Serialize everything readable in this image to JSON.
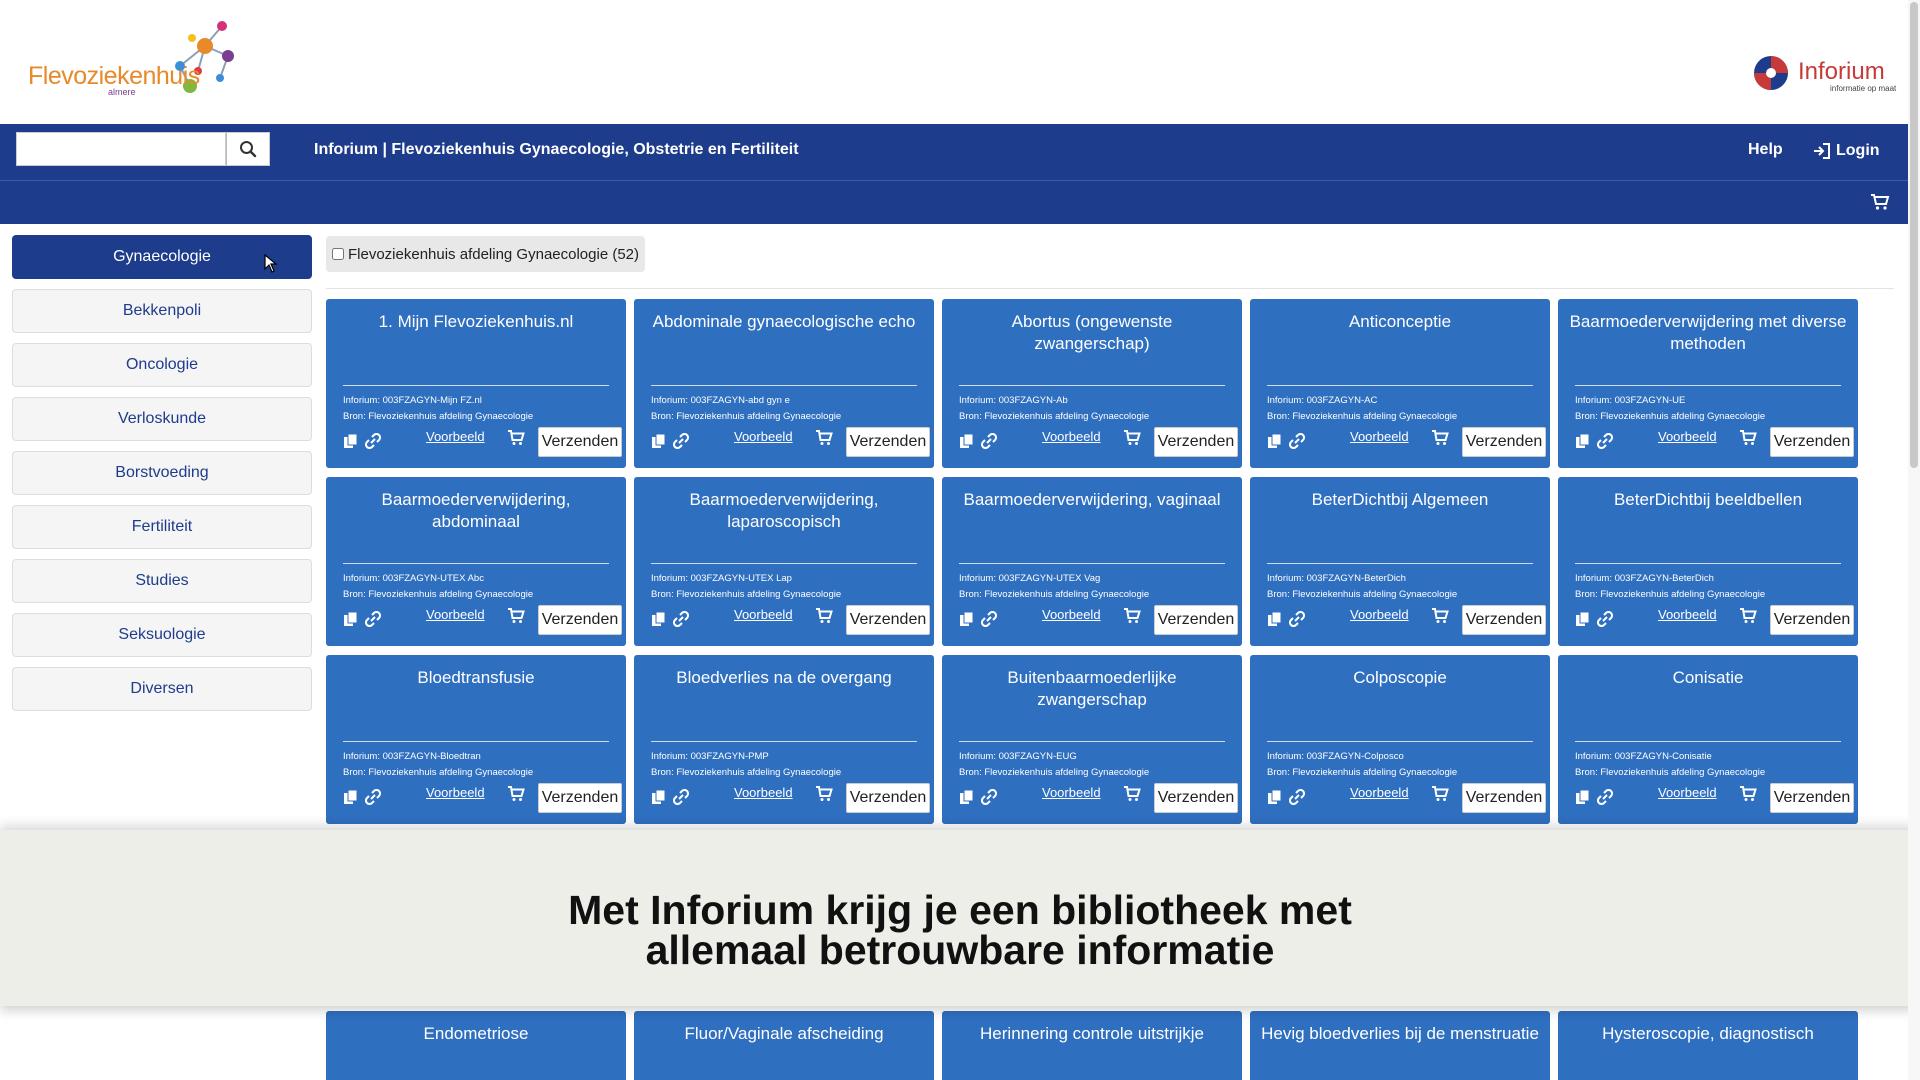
{
  "header": {
    "logo_name": "Flevoziekenhuis",
    "logo_sub": "almere",
    "partner_name": "Inforium",
    "partner_tagline": "informatie op maat"
  },
  "navbar": {
    "search_placeholder": "",
    "title": "Inforium | Flevoziekenhuis Gynaecologie, Obstetrie en Fertiliteit",
    "help_label": "Help",
    "login_label": "Login"
  },
  "sidebar": {
    "items": [
      {
        "label": "Gynaecologie",
        "active": true
      },
      {
        "label": "Bekkenpoli"
      },
      {
        "label": "Oncologie"
      },
      {
        "label": "Verloskunde"
      },
      {
        "label": "Borstvoeding"
      },
      {
        "label": "Fertiliteit"
      },
      {
        "label": "Studies"
      },
      {
        "label": "Seksuologie"
      },
      {
        "label": "Diversen"
      }
    ]
  },
  "filter": {
    "label": "Flevoziekenhuis afdeling Gynaecologie (52)"
  },
  "card_common": {
    "source": "Bron: Flevoziekenhuis afdeling Gynaecologie",
    "preview_label": "Voorbeeld",
    "send_label": "Verzenden"
  },
  "cards": [
    {
      "title": "1. Mijn Flevoziekenhuis.nl",
      "code": "Inforium: 003FZAGYN-Mijn FZ.nl"
    },
    {
      "title": "Abdominale gynaecologische echo",
      "code": "Inforium: 003FZAGYN-abd gyn e"
    },
    {
      "title": "Abortus (ongewenste zwangerschap)",
      "code": "Inforium: 003FZAGYN-Ab"
    },
    {
      "title": "Anticonceptie",
      "code": "Inforium: 003FZAGYN-AC"
    },
    {
      "title": "Baarmoederverwijdering met diverse methoden",
      "code": "Inforium: 003FZAGYN-UE"
    },
    {
      "title": "Baarmoederverwijdering, abdominaal",
      "code": "Inforium: 003FZAGYN-UTEX Abc"
    },
    {
      "title": "Baarmoederverwijdering, laparoscopisch",
      "code": "Inforium: 003FZAGYN-UTEX Lap"
    },
    {
      "title": "Baarmoederverwijdering, vaginaal",
      "code": "Inforium: 003FZAGYN-UTEX Vag"
    },
    {
      "title": "BeterDichtbij Algemeen",
      "code": "Inforium: 003FZAGYN-BeterDich"
    },
    {
      "title": "BeterDichtbij beeldbellen",
      "code": "Inforium: 003FZAGYN-BeterDich"
    },
    {
      "title": "Bloedtransfusie",
      "code": "Inforium: 003FZAGYN-Bloedtran"
    },
    {
      "title": "Bloedverlies na de overgang",
      "code": "Inforium: 003FZAGYN-PMP"
    },
    {
      "title": "Buitenbaarmoederlijke zwangerschap",
      "code": "Inforium: 003FZAGYN-EUG"
    },
    {
      "title": "Colposcopie",
      "code": "Inforium: 003FZAGYN-Colposco"
    },
    {
      "title": "Conisatie",
      "code": "Inforium: 003FZAGYN-Conisatie"
    },
    {
      "title": "Endometriose"
    },
    {
      "title": "Fluor/Vaginale afscheiding"
    },
    {
      "title": "Herinnering controle uitstrijkje"
    },
    {
      "title": "Hevig bloedverlies bij de menstruatie"
    },
    {
      "title": "Hysteroscopie, diagnostisch"
    }
  ],
  "overlay": {
    "line1": "Met Inforium krijg je een bibliotheek met",
    "line2": "allemaal betrouwbare informatie"
  },
  "colors": {
    "navbar": "#1e3c8c",
    "card": "#2f6fc0",
    "logo_orange": "#e8892a",
    "partner_red": "#c63a3a"
  },
  "icons": {
    "search": "search-icon",
    "login": "login-icon",
    "cart": "cart-icon",
    "copy": "copy-icon",
    "link": "link-icon"
  }
}
